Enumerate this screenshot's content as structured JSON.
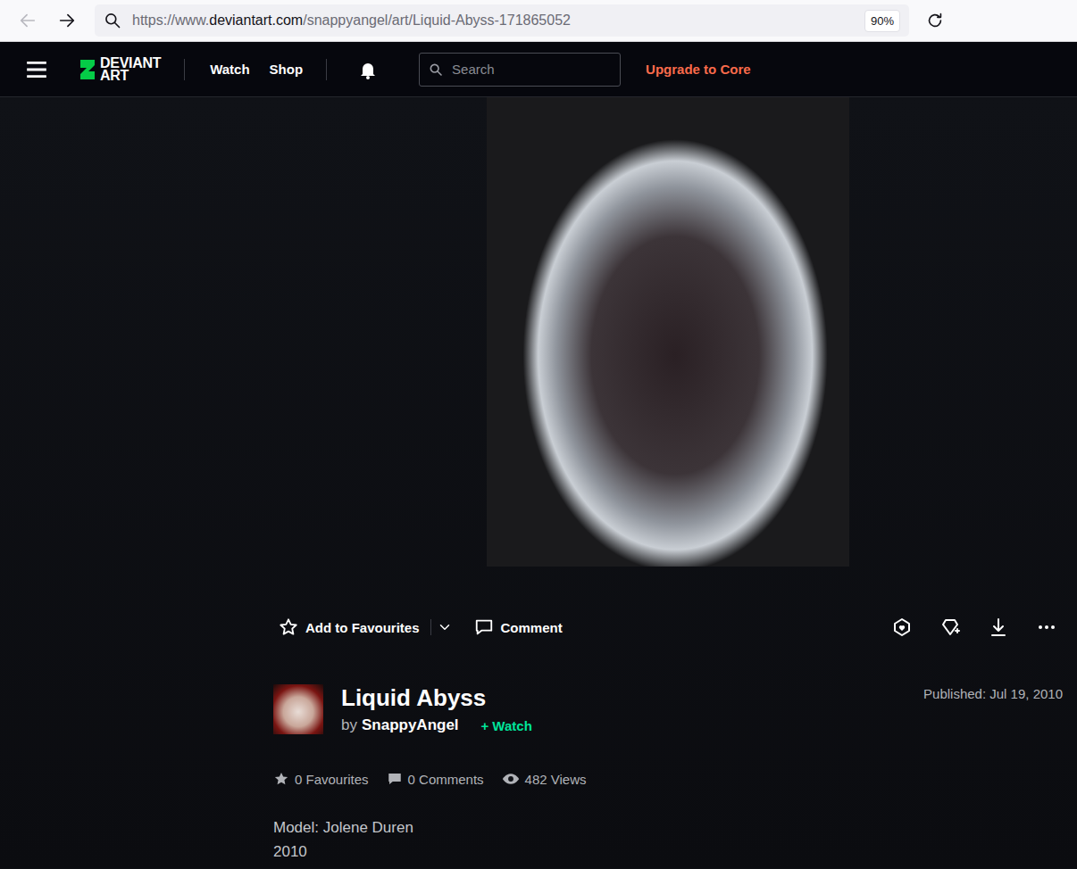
{
  "browser": {
    "back": {
      "disabled": true
    },
    "forward": {
      "disabled": false
    },
    "url": {
      "prefix": "https://www.",
      "domain": "deviantart.com",
      "path": "/snappyangel/art/Liquid-Abyss-171865052"
    },
    "zoom": "90%"
  },
  "site_nav": {
    "logo": {
      "line1": "DEVIANT",
      "line2": "ART"
    },
    "links": [
      "Watch",
      "Shop"
    ],
    "search": {
      "placeholder": "Search"
    },
    "upgrade": "Upgrade to Core"
  },
  "actions": {
    "favourite": "Add to Favourites",
    "comment": "Comment"
  },
  "deviation": {
    "title": "Liquid Abyss",
    "by": "by",
    "author": "SnappyAngel",
    "watch_icon": "+",
    "watch": "Watch",
    "published": "Published: Jul 19, 2010"
  },
  "stats": {
    "favourites": "0 Favourites",
    "comments": "0 Comments",
    "views": "482 Views"
  },
  "description": [
    "Model: Jolene Duren",
    "2010"
  ]
}
